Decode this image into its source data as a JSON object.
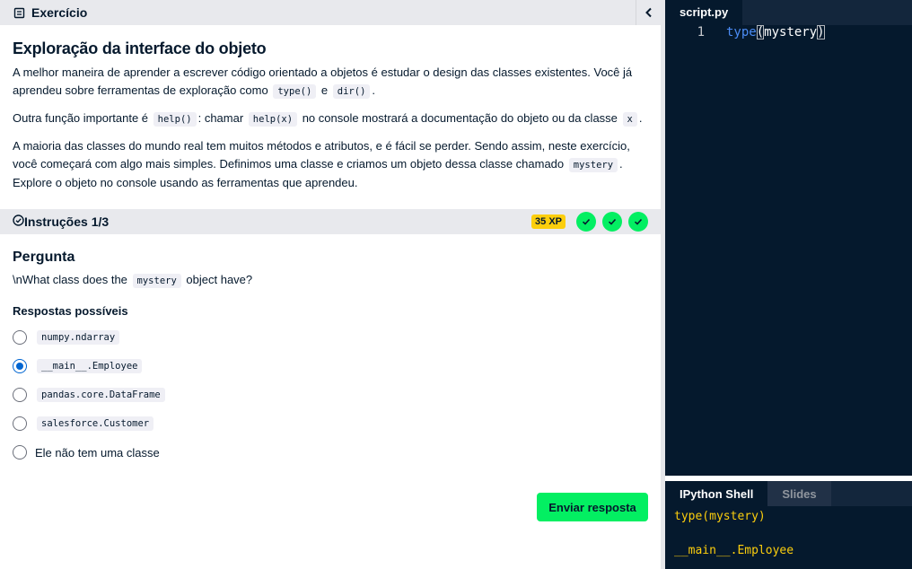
{
  "exercise": {
    "bar_label": "Exercício",
    "title": "Exploração da interface do objeto",
    "p1_a": "A melhor maneira de aprender a escrever código orientado a objetos é estudar o design das classes existentes. Você já aprendeu sobre ferramentas de exploração como",
    "p1_code1": "type()",
    "p1_b": "e",
    "p1_code2": "dir()",
    "p1_c": ".",
    "p2_a": "Outra função importante é",
    "p2_code1": "help()",
    "p2_b": ": chamar",
    "p2_code2": "help(x)",
    "p2_c": "no console mostrará a documentação do objeto ou da classe",
    "p2_code3": "x",
    "p2_d": ".",
    "p3_a": "A maioria das classes do mundo real tem muitos métodos e atributos, e é fácil se perder. Sendo assim, neste exercício, você começará com algo mais simples. Definimos uma classe e criamos um objeto dessa classe chamado",
    "p3_code": "mystery",
    "p3_b": ". Explore o objeto no console usando as ferramentas que aprendeu."
  },
  "instructions": {
    "label": "Instruções 1/3",
    "xp": "35 XP",
    "question_heading": "Pergunta",
    "question_a": "\\nWhat class does the",
    "question_code": "mystery",
    "question_b": "object have?",
    "answers_heading": "Respostas possíveis",
    "options": [
      {
        "text": "numpy.ndarray",
        "code": true,
        "selected": false
      },
      {
        "text": "__main__.Employee",
        "code": true,
        "selected": true
      },
      {
        "text": "pandas.core.DataFrame",
        "code": true,
        "selected": false
      },
      {
        "text": "salesforce.Customer",
        "code": true,
        "selected": false
      },
      {
        "text": "Ele não tem uma classe",
        "code": false,
        "selected": false
      }
    ],
    "submit_label": "Enviar resposta"
  },
  "editor": {
    "tab": "script.py",
    "line_number": "1",
    "code_keyword": "type",
    "code_open": "(",
    "code_arg": "mystery",
    "code_close": ")"
  },
  "console": {
    "tab_active": "IPython Shell",
    "tab_inactive": "Slides",
    "input": "type(mystery)",
    "output": "__main__.Employee"
  },
  "colors": {
    "accent_green": "#03ef62",
    "xp_yellow": "#fcce0d",
    "navy": "#05192d",
    "radio_blue": "#0065d1"
  }
}
